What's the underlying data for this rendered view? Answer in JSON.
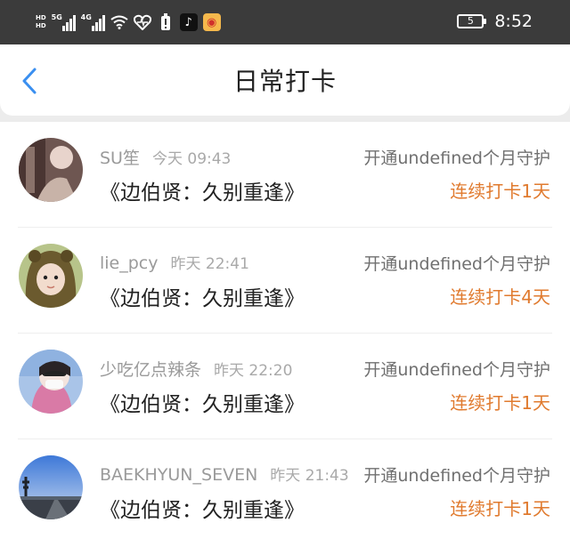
{
  "status_bar": {
    "hd1": "HD",
    "hd2": "HD",
    "net1": "5G",
    "net2": "4G",
    "battery_level": "5",
    "time": "8:52",
    "icons": [
      "wifi-icon",
      "heart-pulse-icon",
      "battery-saver-icon",
      "tiktok-icon",
      "weibo-icon"
    ]
  },
  "header": {
    "title": "日常打卡"
  },
  "records": [
    {
      "user": "SU笙",
      "time": "今天 09:43",
      "subscription": "开通undefined个月守护",
      "book": "《边伯贤：久别重逢》",
      "streak": "连续打卡1天"
    },
    {
      "user": "lie_pcy",
      "time": "昨天 22:41",
      "subscription": "开通undefined个月守护",
      "book": "《边伯贤：久别重逢》",
      "streak": "连续打卡4天"
    },
    {
      "user": "少吃亿点辣条",
      "time": "昨天 22:20",
      "subscription": "开通undefined个月守护",
      "book": "《边伯贤：久别重逢》",
      "streak": "连续打卡1天"
    },
    {
      "user": "BAEKHYUN_SEVEN",
      "time": "昨天 21:43",
      "subscription": "开通undefined个月守护",
      "book": "《边伯贤：久别重逢》",
      "streak": "连续打卡1天"
    }
  ],
  "colors": {
    "status_bar_bg": "#3b3b3b",
    "back_arrow": "#3a8ff0",
    "streak_text": "#e07a2e"
  }
}
